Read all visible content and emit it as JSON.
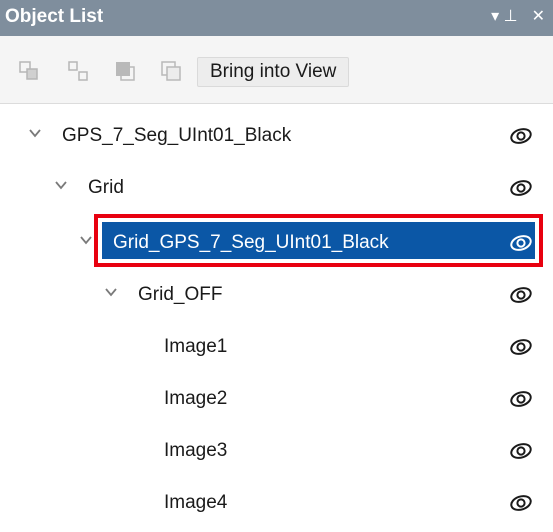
{
  "panel": {
    "title": "Object List",
    "pin_glyph": "▾ ⊥",
    "close_glyph": "✕"
  },
  "toolbar": {
    "bring_into_view": "Bring into View",
    "icons": [
      "group-icon",
      "ungroup-icon",
      "bring-to-front-icon",
      "send-to-back-icon"
    ]
  },
  "tree": {
    "items": [
      {
        "label": "GPS_7_Seg_UInt01_Black",
        "expanded": true,
        "selected": false
      },
      {
        "label": "Grid",
        "expanded": true,
        "selected": false
      },
      {
        "label": "Grid_GPS_7_Seg_UInt01_Black",
        "expanded": true,
        "selected": true
      },
      {
        "label": "Grid_OFF",
        "expanded": true,
        "selected": false
      },
      {
        "label": "Image1",
        "selected": false
      },
      {
        "label": "Image2",
        "selected": false
      },
      {
        "label": "Image3",
        "selected": false
      },
      {
        "label": "Image4",
        "selected": false
      }
    ]
  },
  "colors": {
    "titlebar": "#7f8e9d",
    "selection": "#0b57a6",
    "highlight_border": "#e8000f"
  }
}
